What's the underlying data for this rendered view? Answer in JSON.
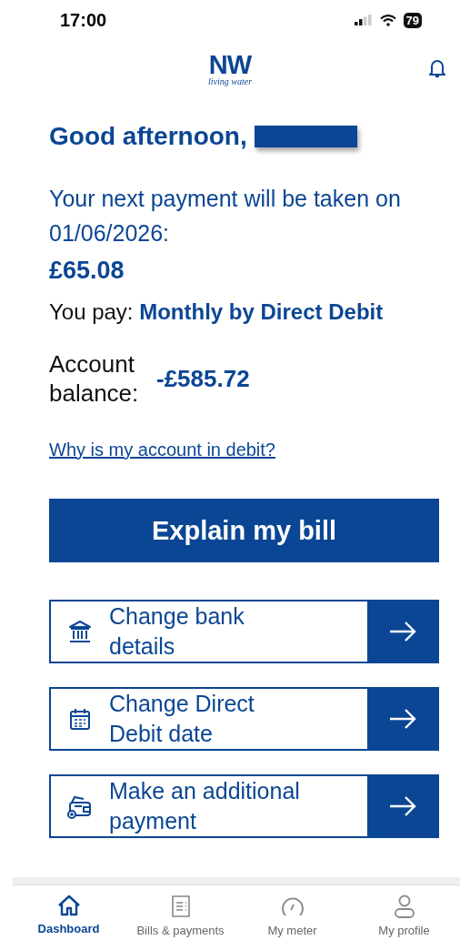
{
  "status_bar": {
    "time": "17:00",
    "battery": "79"
  },
  "header": {
    "logo_mark": "NW",
    "logo_tagline": "living water"
  },
  "greeting": "Good afternoon,",
  "payment": {
    "message": "Your next payment will be taken on 01/06/2026:",
    "amount": "£65.08",
    "method_label": "You pay:",
    "method": "Monthly by Direct Debit",
    "balance_label": "Account balance:",
    "balance": "-£585.72",
    "debit_link": "Why is my account in debit?"
  },
  "primary_button": "Explain my bill",
  "actions": [
    {
      "kind": "bank",
      "label": "Change bank details"
    },
    {
      "kind": "calendar",
      "label": "Change Direct Debit date"
    },
    {
      "kind": "wallet",
      "label": "Make an additional payment"
    }
  ],
  "nav": [
    {
      "kind": "home",
      "label": "Dashboard",
      "selected": true
    },
    {
      "kind": "bill",
      "label": "Bills & payments",
      "selected": false
    },
    {
      "kind": "meter",
      "label": "My meter",
      "selected": false
    },
    {
      "kind": "profile",
      "label": "My profile",
      "selected": false
    }
  ]
}
